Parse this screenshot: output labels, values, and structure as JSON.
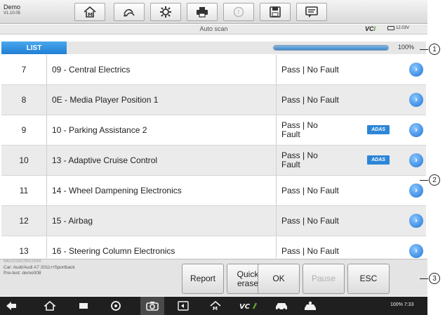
{
  "app": {
    "title": "Demo",
    "version": "V1.10.05"
  },
  "toolbar": {
    "items": [
      {
        "name": "home-icon"
      },
      {
        "name": "vehicle-swap-icon"
      },
      {
        "name": "settings-icon"
      },
      {
        "name": "print-icon"
      },
      {
        "name": "help-icon"
      },
      {
        "name": "save-icon"
      },
      {
        "name": "data-logging-icon"
      }
    ]
  },
  "status": {
    "screen_title": "Auto scan",
    "vci_label": "VC",
    "vci_suffix": "I",
    "battery": "12.03V"
  },
  "list": {
    "tab_label": "LIST",
    "progress_percent": 100,
    "progress_label": "100%"
  },
  "rows": [
    {
      "num": "7",
      "name": "09 - Central Electrics",
      "status": "Pass | No Fault",
      "adas": ""
    },
    {
      "num": "8",
      "name": "0E - Media Player Position 1",
      "status": "Pass | No Fault",
      "adas": ""
    },
    {
      "num": "9",
      "name": "10 - Parking Assistance 2",
      "status": "Pass | No Fault",
      "adas": "ADAS"
    },
    {
      "num": "10",
      "name": "13 - Adaptive Cruise Control",
      "status": "Pass | No Fault",
      "adas": "ADAS"
    },
    {
      "num": "11",
      "name": "14 - Wheel Dampening Electronics",
      "status": "Pass | No Fault",
      "adas": ""
    },
    {
      "num": "12",
      "name": "15 - Airbag",
      "status": "Pass | No Fault",
      "adas": ""
    },
    {
      "num": "13",
      "name": "16 - Steering Column Electronics",
      "status": "Pass | No Fault",
      "adas": ""
    }
  ],
  "row_action_glyph": "›",
  "footer": {
    "vin": "WAUZZZ4G7BN123456",
    "car": "Car: Audi/Audi A7 2011+/Sportback",
    "pretest": "Pre-test: demo008",
    "buttons": {
      "report": "Report",
      "quick_erase_1": "Quick",
      "quick_erase_2": "erase",
      "ok": "OK",
      "pause": "Pause",
      "esc": "ESC"
    }
  },
  "navbar": {
    "battery_time": "100% 7:33"
  },
  "callouts": {
    "c1": "1",
    "c2": "2",
    "c3": "3"
  },
  "colors": {
    "accent": "#2c86d8",
    "list_tab": "#1f7fd3",
    "go_button": "#1f74d6",
    "nav_bg": "#1f1f1f"
  }
}
